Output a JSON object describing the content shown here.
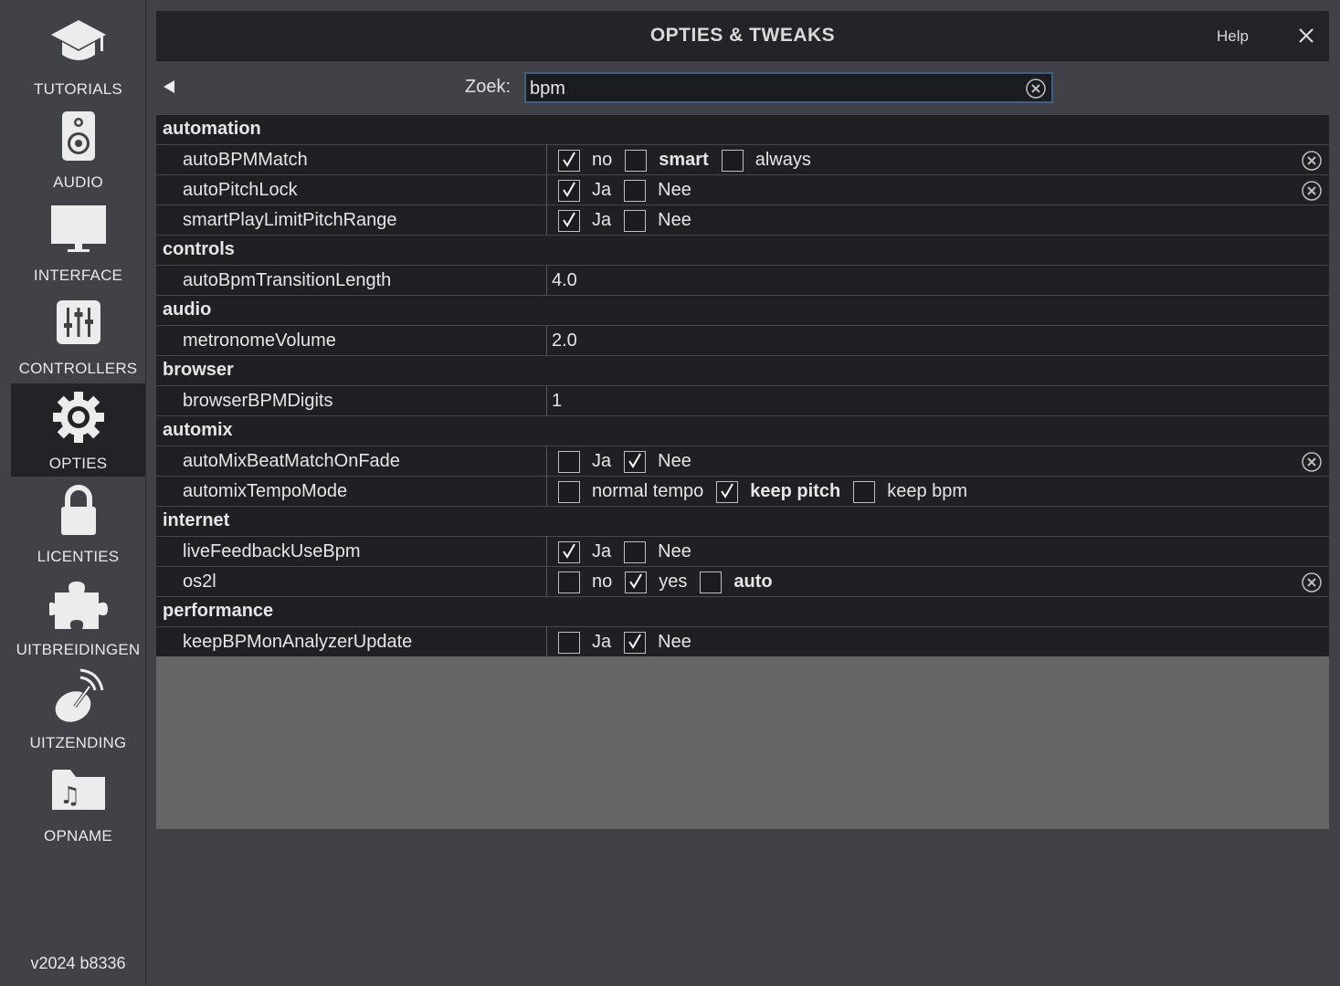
{
  "sidebar": {
    "items": [
      {
        "label": "TUTORIALS",
        "icon": "graduation-cap-icon"
      },
      {
        "label": "AUDIO",
        "icon": "speaker-icon"
      },
      {
        "label": "INTERFACE",
        "icon": "monitor-icon"
      },
      {
        "label": "CONTROLLERS",
        "icon": "mixer-sliders-icon"
      },
      {
        "label": "OPTIES",
        "icon": "gear-icon",
        "active": true
      },
      {
        "label": "LICENTIES",
        "icon": "lock-icon"
      },
      {
        "label": "UITBREIDINGEN",
        "icon": "puzzle-piece-icon"
      },
      {
        "label": "UITZENDING",
        "icon": "satellite-dish-icon"
      },
      {
        "label": "OPNAME",
        "icon": "music-folder-icon"
      }
    ],
    "version": "v2024 b8336"
  },
  "header": {
    "title": "OPTIES & TWEAKS",
    "help_label": "Help"
  },
  "search": {
    "label": "Zoek:",
    "value": "bpm"
  },
  "categories": [
    {
      "name": "automation"
    },
    {
      "name": "controls"
    },
    {
      "name": "audio"
    },
    {
      "name": "browser"
    },
    {
      "name": "automix"
    },
    {
      "name": "internet"
    },
    {
      "name": "performance"
    }
  ],
  "rows": {
    "autoBPMMatch": {
      "name": "autoBPMMatch",
      "options": [
        "no",
        "smart",
        "always"
      ],
      "checked": "no",
      "bold": "smart"
    },
    "autoPitchLock": {
      "name": "autoPitchLock",
      "options": [
        "Ja",
        "Nee"
      ],
      "checked": "Ja"
    },
    "smartPlayLimitPitchRange": {
      "name": "smartPlayLimitPitchRange",
      "options": [
        "Ja",
        "Nee"
      ],
      "checked": "Ja"
    },
    "autoBpmTransitionLength": {
      "name": "autoBpmTransitionLength",
      "value": "4.0"
    },
    "metronomeVolume": {
      "name": "metronomeVolume",
      "value": "2.0"
    },
    "browserBPMDigits": {
      "name": "browserBPMDigits",
      "value": "1"
    },
    "autoMixBeatMatchOnFade": {
      "name": "autoMixBeatMatchOnFade",
      "options": [
        "Ja",
        "Nee"
      ],
      "checked": "Nee"
    },
    "automixTempoMode": {
      "name": "automixTempoMode",
      "options": [
        "normal tempo",
        "keep pitch",
        "keep bpm"
      ],
      "checked": "keep pitch",
      "bold": "keep pitch"
    },
    "liveFeedbackUseBpm": {
      "name": "liveFeedbackUseBpm",
      "options": [
        "Ja",
        "Nee"
      ],
      "checked": "Ja"
    },
    "os2l": {
      "name": "os2l",
      "options": [
        "no",
        "yes",
        "auto"
      ],
      "checked": "yes",
      "bold": "auto"
    },
    "keepBPMonAnalyzerUpdate": {
      "name": "keepBPMonAnalyzerUpdate",
      "options": [
        "Ja",
        "Nee"
      ],
      "checked": "Nee"
    }
  },
  "colors": {
    "background": "#404247",
    "panel_empty": "#666669",
    "row_bg": "#1f2023",
    "active_nav": "#222326",
    "search_border": "#3f5f86"
  }
}
